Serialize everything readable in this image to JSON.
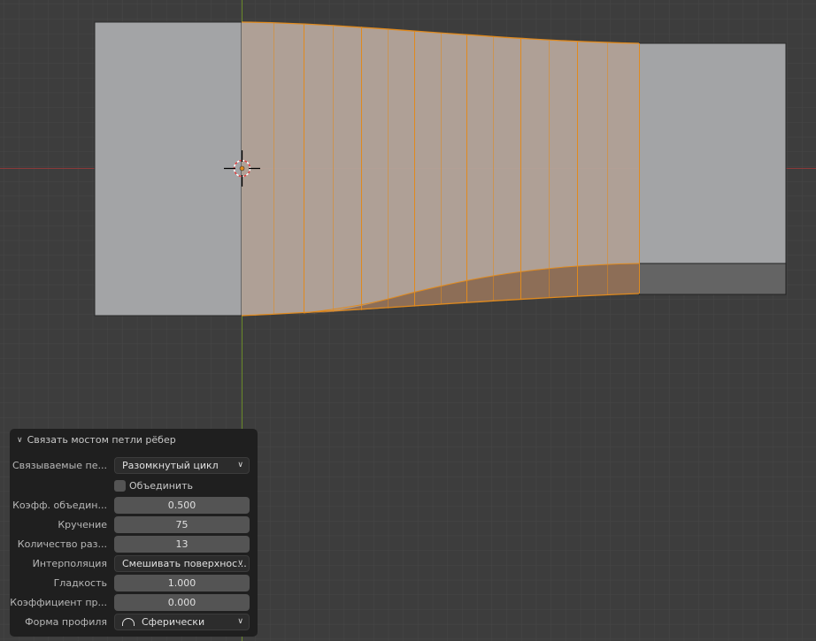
{
  "viewport": {
    "colors": {
      "background": "#3d3d3d",
      "mesh": "#a3a4a6",
      "mesh_dark": "#646464",
      "selected_face": "#b5a59b",
      "selected_edge": "#e08a1e",
      "x_axis": "#9a3a3a",
      "y_axis": "#6a8a2a"
    },
    "bridge_cuts": 13
  },
  "panel": {
    "title": "Связать мостом петли рёбер",
    "collapse_icon": "chevron-down-icon",
    "rows": [
      {
        "label": "Связываемые пе...",
        "value": "Разомкнутый цикл",
        "type": "dropdown"
      },
      {
        "label": "",
        "value": "Объединить",
        "type": "checkbox",
        "checked": false
      },
      {
        "label": "Коэфф. объедин...",
        "value": "0.500",
        "type": "number"
      },
      {
        "label": "Кручение",
        "value": "75",
        "type": "number"
      },
      {
        "label": "Количество раз...",
        "value": "13",
        "type": "number"
      },
      {
        "label": "Интерполяция",
        "value": "Смешивать поверхнос...",
        "type": "dropdown"
      },
      {
        "label": "Гладкость",
        "value": "1.000",
        "type": "number"
      },
      {
        "label": "Коэффициент пр...",
        "value": "0.000",
        "type": "number"
      },
      {
        "label": "Форма профиля",
        "value": "Сферически",
        "type": "dropdown",
        "icon": "sphere-profile-icon"
      }
    ]
  }
}
